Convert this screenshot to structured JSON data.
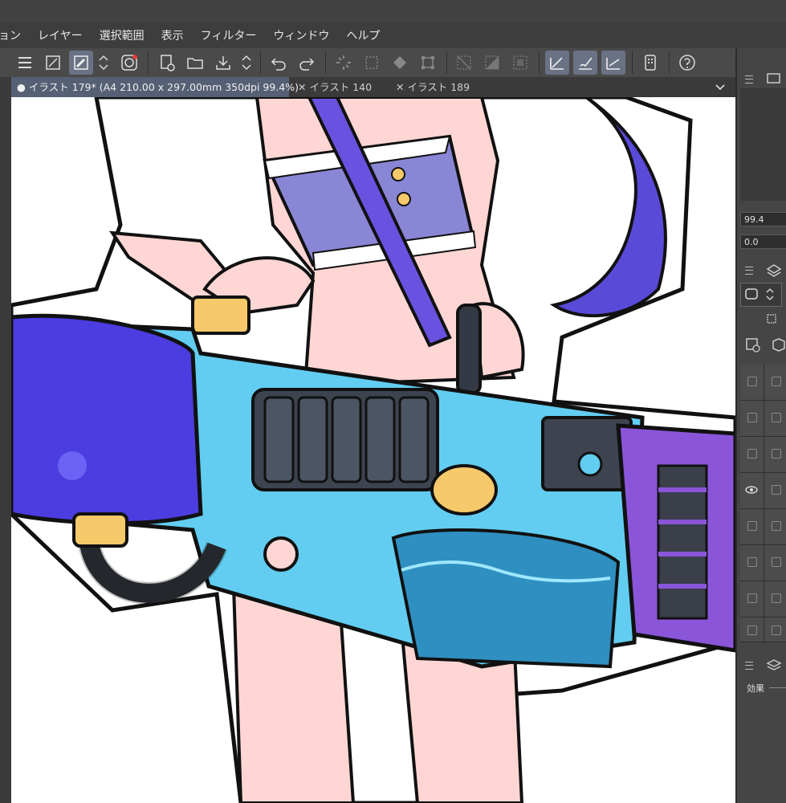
{
  "menu": [
    "ョン",
    "レイヤー",
    "選択範囲",
    "表示",
    "フィルター",
    "ウィンドウ",
    "ヘルプ"
  ],
  "toolbar": {
    "icons": [
      "menu-icon",
      "fullscreen-icon",
      "eyedropper-icon",
      "up-down-arrows-icon",
      "spiral-logo-icon",
      "new-file-icon",
      "open-folder-icon",
      "save-icon",
      "up-down-arrows-icon",
      "undo-icon",
      "redo-icon",
      "loading-icon",
      "selection-dots-icon",
      "fill-icon",
      "transform-icon",
      "deselect-icon",
      "invert-selection-icon",
      "select-all-icon",
      "pen-angle-icon",
      "brush-icon",
      "ruler-angle-icon",
      "smartphone-icon",
      "help-icon"
    ]
  },
  "tabs": [
    {
      "label": "イラスト 179* (A4 210.00 x 297.00mm 350dpi 99.4%)",
      "active": true
    },
    {
      "label": "イラスト 140",
      "active": false
    },
    {
      "label": "イラスト 189",
      "active": false
    }
  ],
  "right_panel": {
    "opacity_value": "99.4",
    "angle_value": "0.0",
    "effects_label": "効果"
  },
  "colors": {
    "bg": "#3b3b3b",
    "toolbar": "#4a4a4a",
    "active_tab": "#556074",
    "blaster_blue": "#62cdf0",
    "barrel_purple": "#4b3de0",
    "nozzle_purple": "#8a55d9",
    "hair_purple": "#5a4ad8",
    "knob_yellow": "#f6c96a",
    "skin": "#ffd6d4"
  }
}
